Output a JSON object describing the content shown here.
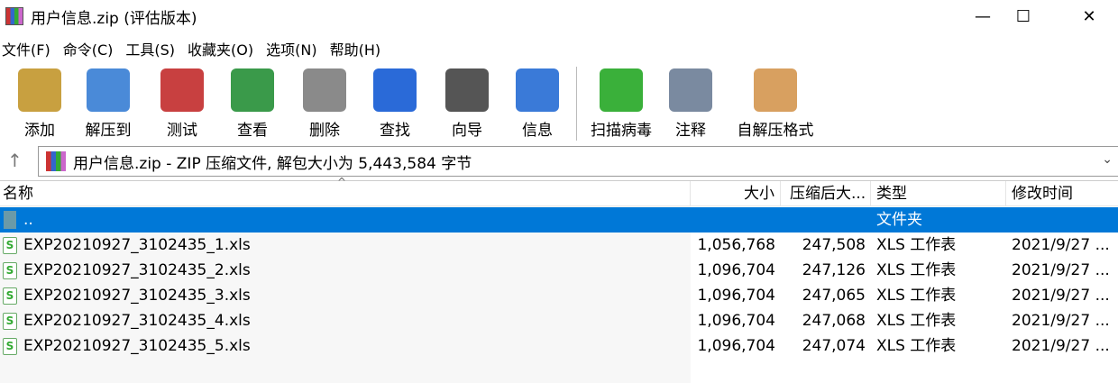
{
  "window": {
    "title": "用户信息.zip (评估版本)",
    "minimize": "—",
    "maximize": "☐",
    "close": "✕"
  },
  "menu": [
    "文件(F)",
    "命令(C)",
    "工具(S)",
    "收藏夹(O)",
    "选项(N)",
    "帮助(H)"
  ],
  "toolbar": [
    {
      "label": "添加",
      "icon": "add-archive-icon",
      "color": "#c8a040"
    },
    {
      "label": "解压到",
      "icon": "extract-folder-icon",
      "color": "#4a8ad8"
    },
    {
      "label": "测试",
      "icon": "test-clipboard-icon",
      "color": "#c84040"
    },
    {
      "label": "查看",
      "icon": "view-book-icon",
      "color": "#3a9a4a"
    },
    {
      "label": "删除",
      "icon": "delete-trash-icon",
      "color": "#8a8a8a"
    },
    {
      "label": "查找",
      "icon": "find-magnifier-icon",
      "color": "#2a6ad8"
    },
    {
      "label": "向导",
      "icon": "wizard-wand-icon",
      "color": "#555555"
    },
    {
      "label": "信息",
      "icon": "info-icon",
      "color": "#3a7ad8"
    },
    {
      "label": "扫描病毒",
      "icon": "virus-scan-icon",
      "color": "#3ab03a"
    },
    {
      "label": "注释",
      "icon": "comment-icon",
      "color": "#7a8aa0"
    },
    {
      "label": "自解压格式",
      "icon": "sfx-box-icon",
      "color": "#d8a060"
    }
  ],
  "address": {
    "up": "↑",
    "text": "用户信息.zip - ZIP 压缩文件, 解包大小为 5,443,584 字节",
    "dropdown": "⌄"
  },
  "columns": {
    "name": "名称",
    "size": "大小",
    "packed": "压缩后大...",
    "type": "类型",
    "modified": "修改时间"
  },
  "parent": {
    "name": "..",
    "type": "文件夹"
  },
  "files": [
    {
      "name": "EXP20210927_3102435_1.xls",
      "size": "1,056,768",
      "packed": "247,508",
      "type": "XLS 工作表",
      "modified": "2021/9/27 ..."
    },
    {
      "name": "EXP20210927_3102435_2.xls",
      "size": "1,096,704",
      "packed": "247,126",
      "type": "XLS 工作表",
      "modified": "2021/9/27 ..."
    },
    {
      "name": "EXP20210927_3102435_3.xls",
      "size": "1,096,704",
      "packed": "247,065",
      "type": "XLS 工作表",
      "modified": "2021/9/27 ..."
    },
    {
      "name": "EXP20210927_3102435_4.xls",
      "size": "1,096,704",
      "packed": "247,068",
      "type": "XLS 工作表",
      "modified": "2021/9/27 ..."
    },
    {
      "name": "EXP20210927_3102435_5.xls",
      "size": "1,096,704",
      "packed": "247,074",
      "type": "XLS 工作表",
      "modified": "2021/9/27 ..."
    }
  ]
}
